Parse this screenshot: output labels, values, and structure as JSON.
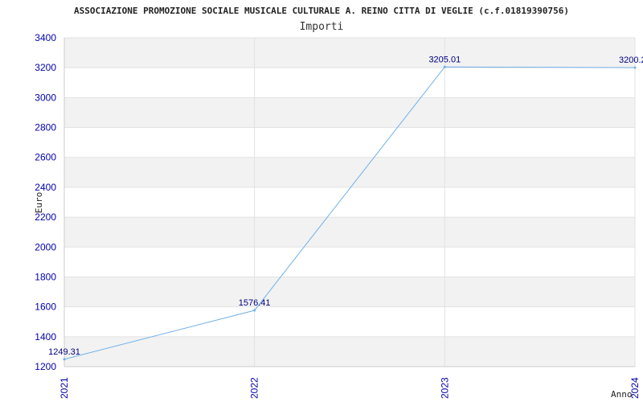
{
  "chart_data": {
    "type": "line",
    "title": "ASSOCIAZIONE PROMOZIONE SOCIALE MUSICALE CULTURALE A. REINO CITTA DI VEGLIE (c.f.01819390756)",
    "subtitle": "Importi",
    "xlabel": "Anno",
    "ylabel": "Euro",
    "categories": [
      "2021",
      "2022",
      "2023",
      "2024"
    ],
    "series": [
      {
        "values": [
          1249.31,
          1576.41,
          3205.01,
          3200.2
        ],
        "labels": [
          "1249.31",
          "1576.41",
          "3205.01",
          "3200.2"
        ]
      }
    ],
    "ylim": [
      1200,
      3400
    ],
    "yticks": [
      "1200",
      "1400",
      "1600",
      "1800",
      "2000",
      "2200",
      "2400",
      "2600",
      "2800",
      "3000",
      "3200",
      "3400"
    ],
    "grid": true,
    "colors": {
      "line": "#6fb0e8",
      "band": "#f2f2f2",
      "tick_text": "#0000aa",
      "label_text": "#000080"
    }
  }
}
